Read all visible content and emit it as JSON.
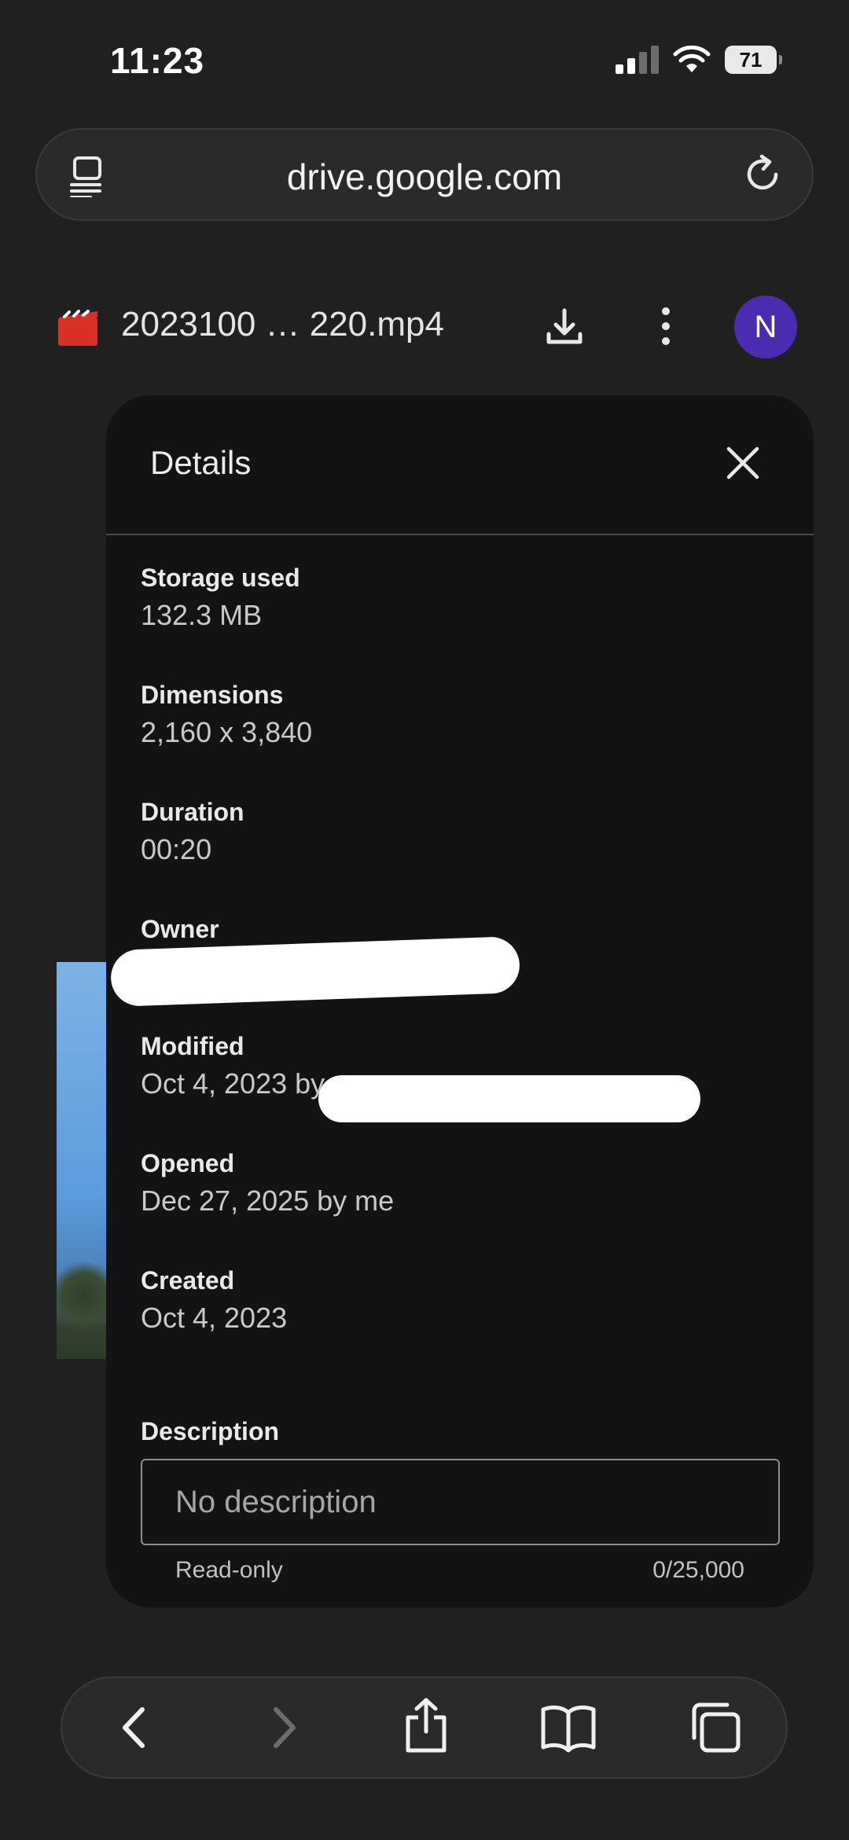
{
  "status_bar": {
    "time": "11:23",
    "battery": "71"
  },
  "browser": {
    "url": "drive.google.com"
  },
  "file_header": {
    "file_name": "2023100 … 220.mp4",
    "avatar_letter": "N",
    "avatar_color": "#4b2bb0",
    "file_icon_color": "#d93025"
  },
  "details": {
    "title": "Details",
    "fields": [
      {
        "label": "Storage used",
        "value": "132.3 MB"
      },
      {
        "label": "Dimensions",
        "value": "2,160 x 3,840"
      },
      {
        "label": "Duration",
        "value": "00:20"
      },
      {
        "label": "Owner",
        "value": ""
      },
      {
        "label": "Modified",
        "value": "Oct 4, 2023 by"
      },
      {
        "label": "Opened",
        "value": "Dec 27, 2025 by me"
      },
      {
        "label": "Created",
        "value": "Oct 4, 2023"
      }
    ],
    "description_label": "Description",
    "description_placeholder": "No description",
    "readonly_text": "Read-only",
    "char_counter": "0/25,000"
  }
}
